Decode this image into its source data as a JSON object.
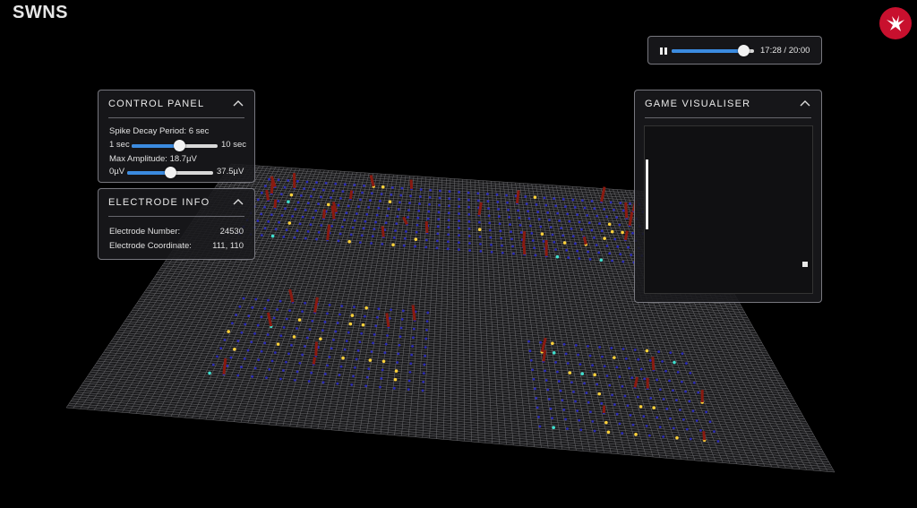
{
  "watermark": "SWNS",
  "brand_logo": {
    "icon": "eagle-logo-icon",
    "color": "#c8102e"
  },
  "playback": {
    "play_pause_icon": "pause-icon",
    "time_text": "17:28 / 20:00",
    "progress_fraction": 0.874
  },
  "control_panel": {
    "title": "CONTROL PANEL",
    "spike_decay": {
      "label": "Spike Decay Period: 6 sec",
      "min_label": "1 sec",
      "max_label": "10 sec",
      "value_fraction": 0.556
    },
    "max_amplitude": {
      "label": "Max Amplitude: 18.7µV",
      "min_label": "0µV",
      "max_label": "37.5µV",
      "value_fraction": 0.5
    }
  },
  "electrode_info": {
    "title": "ELECTRODE INFO",
    "number_label": "Electrode Number:",
    "number_value": "24530",
    "coordinate_label": "Electrode Coordinate:",
    "coordinate_value": "111, 110"
  },
  "game_visualiser": {
    "title": "GAME VISUALISER"
  },
  "colors": {
    "accent": "#3b8be0",
    "electrode": "#2b2bb8",
    "spike": "#ffd23a",
    "spike_alt": "#3fe0d0",
    "bar": "#8a1a10"
  }
}
